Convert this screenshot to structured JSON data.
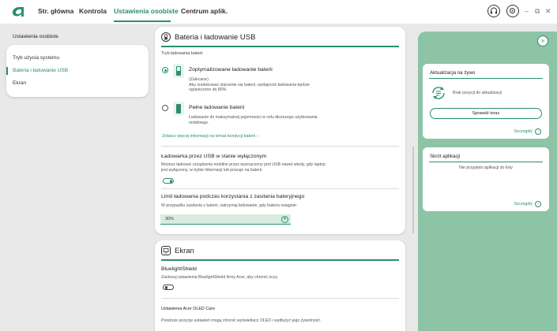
{
  "nav": {
    "items": [
      "Str. główna",
      "Kontrola",
      "Ustawienia osobiste",
      "Centrum aplik."
    ],
    "active_index": 2
  },
  "window_buttons": {
    "minimize": "–",
    "restore": "⧉",
    "close": "✕"
  },
  "sidebar": {
    "title": "Ustawienia osobiste",
    "items": [
      "Tryb użycia systemu",
      "Bateria i ładowanie USB",
      "Ekran"
    ],
    "active_index": 1
  },
  "battery_card": {
    "title": "Bateria i ładowanie USB",
    "mode_label": "Tryb ładowania baterii",
    "option1_title": "Zoptymalizowane ładowanie baterii",
    "option1_desc": "(Zalecane)\nAby zredukować starzenie się baterii, wydajność ładowania będzie ograniczone do 80%.",
    "option2_title": "Pełne ładowanie baterii",
    "option2_desc": "Ładowanie do maksymalnej pojemności w celu dłuższego użytkowania mobilnego.",
    "selected_option": 1,
    "more_link": "Zobacz więcej informacji na temat kondycji baterii  ›",
    "usb_title": "Ładowarka przez USB w stanie wyłączonym",
    "usb_desc": "Możesz ładować urządzenia mobilne przez wyznaczony port USB nawet wtedy, gdy laptop jest wyłączony, w trybie hibernacji lub pracuje na baterii.",
    "usb_toggle_on": true,
    "limit_title": "Limit ładowania podczas korzystania z zasilania bateryjnego",
    "limit_desc": "W przypadku zasilania z baterii, zatrzymaj ładowanie, gdy bateria osiągnie:",
    "limit_value": "30%"
  },
  "screen_card": {
    "title": "Ekran",
    "bls_title": "BluelightShield",
    "bls_desc": "Zastosuj ustawienia BluelightShield firmy Acer, aby chronić oczy.",
    "bls_toggle_on": false,
    "oled_title": "Ustawienia Acer OLED Care",
    "oled_desc": "Poniższe pozycje ustawień mogą chronić wyświetlacz OLED i wydłużyć jego żywotność."
  },
  "right_panel": {
    "live_update": {
      "title": "Aktualizacja na żywo",
      "empty_text": "Brak pozycji do aktualizacji",
      "check_button": "Sprawdź teraz",
      "more": "Szczegóły"
    },
    "shortcut": {
      "title": "Skrót aplikacji",
      "empty_text": "Nie przypięto aplikacji do listy",
      "more": "Szczegóły"
    }
  },
  "colors": {
    "accent": "#2a8f6b",
    "right_panel": "#8ec4a6"
  }
}
